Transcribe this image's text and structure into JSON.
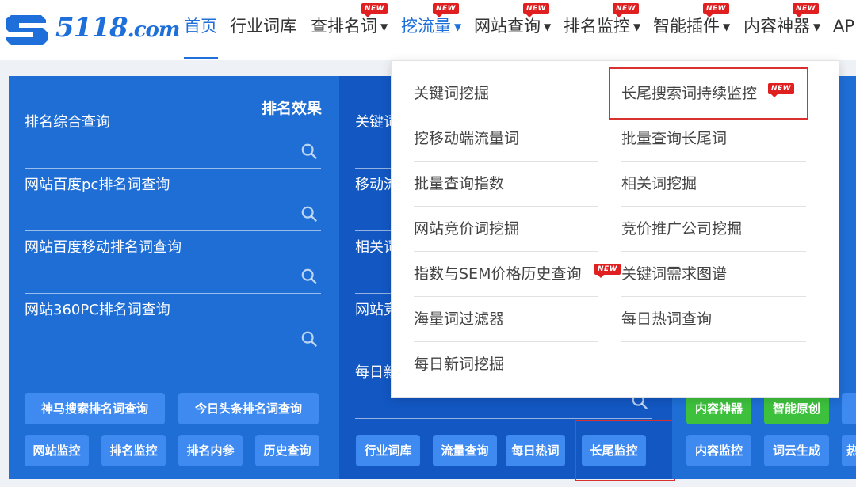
{
  "header": {
    "logo_text": "5118",
    "logo_suffix": ".com",
    "nav": [
      {
        "label": "首页"
      },
      {
        "label": "行业词库"
      },
      {
        "label": "查排名词",
        "badge": "NEW"
      },
      {
        "label": "挖流量",
        "badge": "NEW"
      },
      {
        "label": "网站查询",
        "badge": "NEW"
      },
      {
        "label": "排名监控",
        "badge": "NEW"
      },
      {
        "label": "智能插件",
        "badge": "NEW"
      },
      {
        "label": "内容神器",
        "badge": "NEW"
      },
      {
        "label": "AP"
      }
    ]
  },
  "left_panel": {
    "title": "排名效果",
    "searches": [
      {
        "label": "排名综合查询"
      },
      {
        "label": "网站百度pc排名词查询"
      },
      {
        "label": "网站百度移动排名词查询"
      },
      {
        "label": "网站360PC排名词查询"
      }
    ],
    "buttons_row1": [
      "神马搜索排名词查询",
      "今日头条排名词查询"
    ],
    "buttons_row2": [
      "网站监控",
      "排名监控",
      "排名内参",
      "历史查询"
    ]
  },
  "mid_panel": {
    "searches": [
      {
        "label": "关键词"
      },
      {
        "label": "移动流"
      },
      {
        "label": "相关词"
      },
      {
        "label": "网站竞"
      },
      {
        "label": "每日新"
      }
    ],
    "buttons": [
      "行业词库",
      "流量查询",
      "每日热词",
      "长尾监控"
    ]
  },
  "right_panel": {
    "buttons_row1": [
      "内容神器",
      "智能原创"
    ],
    "buttons_row2": [
      "内容监控",
      "词云生成",
      "热"
    ]
  },
  "dropdown": {
    "left": [
      "关键词挖掘",
      "挖移动端流量词",
      "批量查询指数",
      "网站竞价词挖掘",
      "指数与SEM价格历史查询",
      "海量词过滤器",
      "每日新词挖掘"
    ],
    "right": [
      "长尾搜索词持续监控",
      "批量查询长尾词",
      "相关词挖掘",
      "竞价推广公司挖掘",
      "关键词需求图谱",
      "每日热词查询"
    ],
    "badge": "NEW"
  },
  "colors": {
    "brand": "#1e6fd9",
    "badge": "#e02020",
    "highlight_box": "#d93030",
    "green_button": "#3dc13c"
  }
}
